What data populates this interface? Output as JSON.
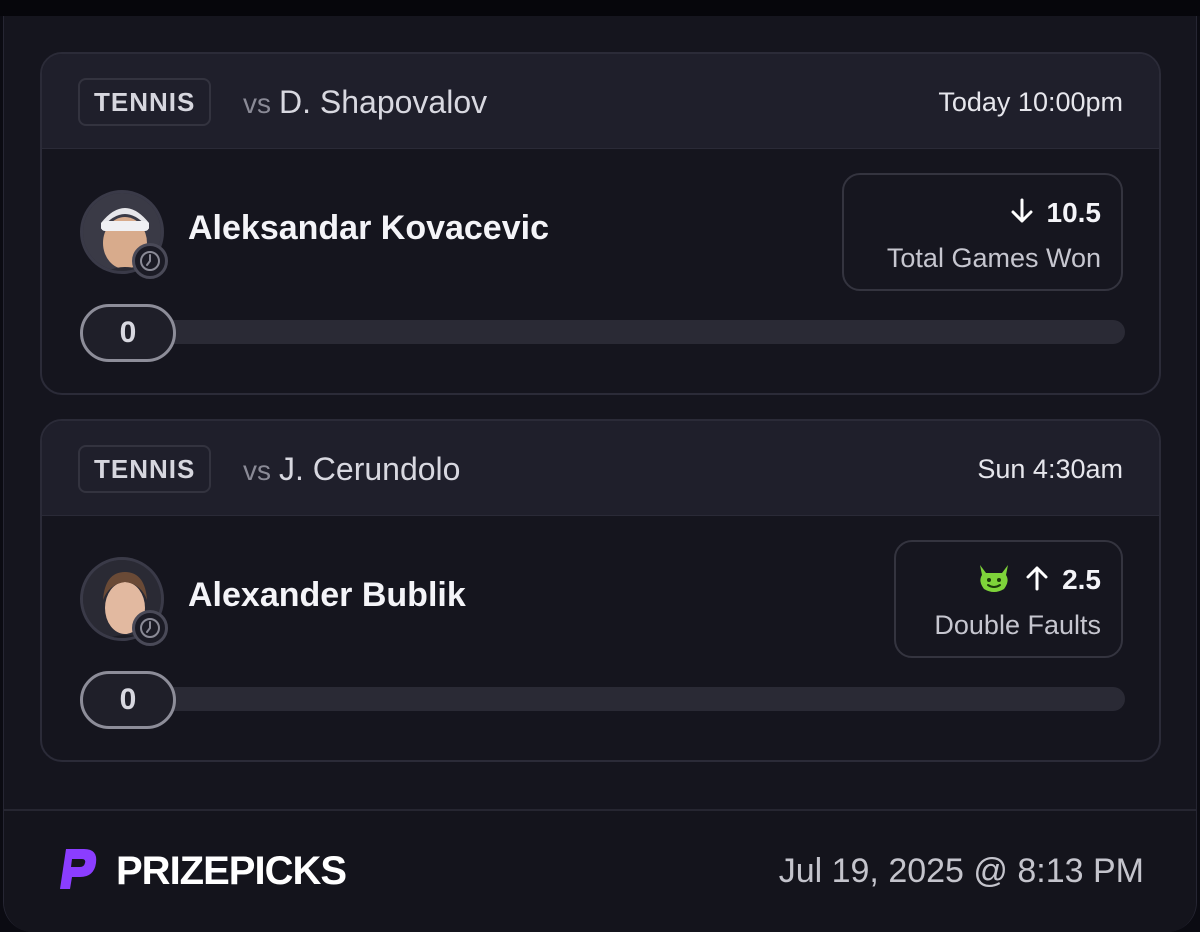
{
  "picks": [
    {
      "sport": "TENNIS",
      "vs_prefix": "vs",
      "opponent": "D. Shapovalov",
      "time": "Today 10:00pm",
      "player": "Aleksandar Kovacevic",
      "direction": "down",
      "direction_icon": "arrow-down-icon",
      "line": "10.5",
      "stat": "Total Games Won",
      "progress_value": "0",
      "progress_fraction": 0,
      "has_demon": false
    },
    {
      "sport": "TENNIS",
      "vs_prefix": "vs",
      "opponent": "J. Cerundolo",
      "time": "Sun 4:30am",
      "player": "Alexander Bublik",
      "direction": "up",
      "direction_icon": "arrow-up-icon",
      "line": "2.5",
      "stat": "Double Faults",
      "progress_value": "0",
      "progress_fraction": 0,
      "has_demon": true,
      "demon_icon": "green-demon-icon"
    }
  ],
  "footer": {
    "brand": "PRIZEPICKS",
    "brand_icon": "prizepicks-logo-icon",
    "timestamp": "Jul 19, 2025 @ 8:13 PM"
  },
  "colors": {
    "brand_purple": "#8b3dff",
    "demon_green": "#7ed33a",
    "panel_bg": "#15151e"
  }
}
